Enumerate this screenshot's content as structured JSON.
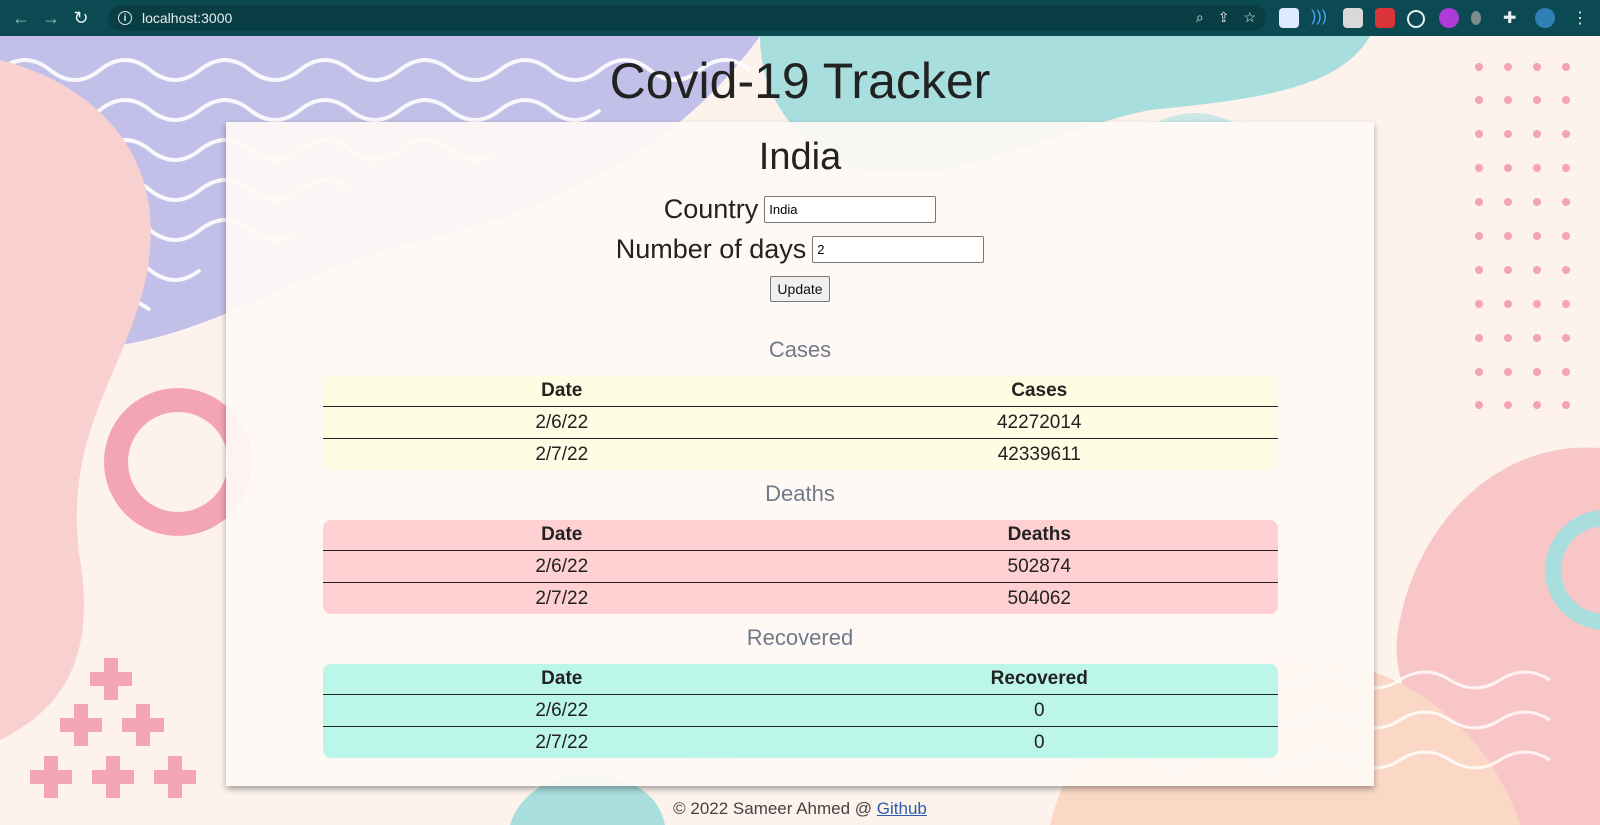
{
  "browser": {
    "url": "localhost:3000",
    "colors": {
      "toolbar": "#0b4a52",
      "omnibox": "#093e45"
    }
  },
  "page": {
    "title": "Covid-19 Tracker",
    "country_heading": "India",
    "form": {
      "country_label": "Country",
      "country_value": "India",
      "days_label": "Number of days",
      "days_value": "2",
      "update_label": "Update"
    },
    "sections": [
      {
        "title": "Cases",
        "color": "#fefde3",
        "headers": [
          "Date",
          "Cases"
        ],
        "rows": [
          [
            "2/6/22",
            "42272014"
          ],
          [
            "2/7/22",
            "42339611"
          ]
        ]
      },
      {
        "title": "Deaths",
        "color": "#ffd0d2",
        "headers": [
          "Date",
          "Deaths"
        ],
        "rows": [
          [
            "2/6/22",
            "502874"
          ],
          [
            "2/7/22",
            "504062"
          ]
        ]
      },
      {
        "title": "Recovered",
        "color": "#bcf6e8",
        "headers": [
          "Date",
          "Recovered"
        ],
        "rows": [
          [
            "2/6/22",
            "0"
          ],
          [
            "2/7/22",
            "0"
          ]
        ]
      }
    ],
    "footer": {
      "text": "© 2022 Sameer Ahmed @ ",
      "link": "Github"
    }
  }
}
